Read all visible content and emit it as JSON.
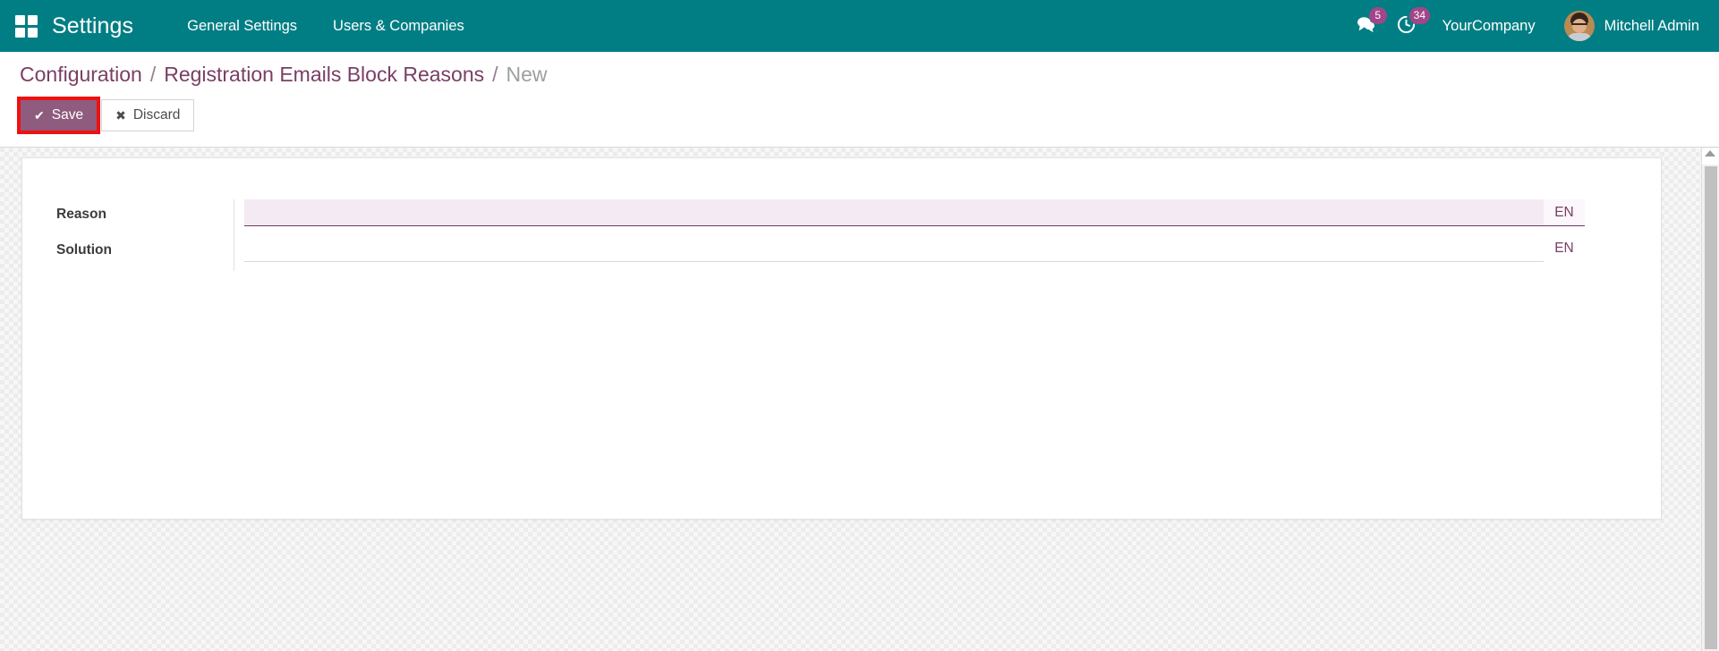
{
  "navbar": {
    "apps_icon": "grid-apps-icon",
    "brand": "Settings",
    "menu_items": [
      {
        "label": "General Settings"
      },
      {
        "label": "Users & Companies"
      }
    ],
    "systray": [
      {
        "icon": "messaging-icon",
        "glyph": "💬",
        "count": "5"
      },
      {
        "icon": "activity-clock-icon",
        "glyph": "◔",
        "count": "34"
      }
    ],
    "company": "YourCompany",
    "user": "Mitchell Admin",
    "avatar_icon": "user-avatar",
    "colors": {
      "navbar_bg": "#017e84",
      "badge_bg": "#a24689",
      "text": "#ffffff"
    }
  },
  "control_panel": {
    "breadcrumb": {
      "items": [
        {
          "label": "Configuration",
          "current": false
        },
        {
          "label": "Registration Emails Block Reasons",
          "current": false
        },
        {
          "label": "New",
          "current": true
        }
      ],
      "separator": "/"
    },
    "buttons": {
      "save": {
        "label": "Save",
        "icon": "check-icon",
        "glyph": "✔",
        "highlight_color": "#ee1111",
        "bg_color": "#8f5b7e"
      },
      "discard": {
        "label": "Discard",
        "icon": "times-icon",
        "glyph": "✖"
      }
    }
  },
  "form": {
    "fields": [
      {
        "label": "Reason",
        "value": "",
        "placeholder": "",
        "lang": "EN",
        "focused": true
      },
      {
        "label": "Solution",
        "value": "",
        "placeholder": "",
        "lang": "EN",
        "focused": false
      }
    ]
  },
  "scrollbar": {
    "arrow_up_icon": "caret-up-icon"
  }
}
